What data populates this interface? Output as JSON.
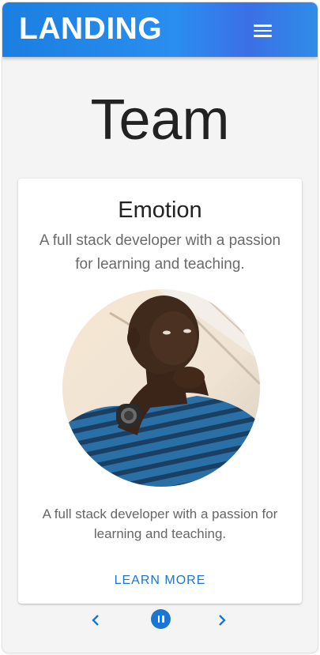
{
  "appbar": {
    "brand": "LANDING",
    "menu_icon": "hamburger-menu-icon"
  },
  "page": {
    "title": "Team"
  },
  "card": {
    "title": "Emotion",
    "subtitle": "A full stack developer with a passion for learning and teaching.",
    "image": "profile-photo",
    "body": "A full stack developer with a passion for learning and teaching.",
    "action_label": "LEARN MORE"
  },
  "carousel": {
    "prev_icon": "chevron-left-icon",
    "pause_icon": "pause-icon",
    "next_icon": "chevron-right-icon"
  },
  "colors": {
    "appbar": "#2a8ef0",
    "accent": "#1976d2",
    "background": "#f4f4f4"
  }
}
